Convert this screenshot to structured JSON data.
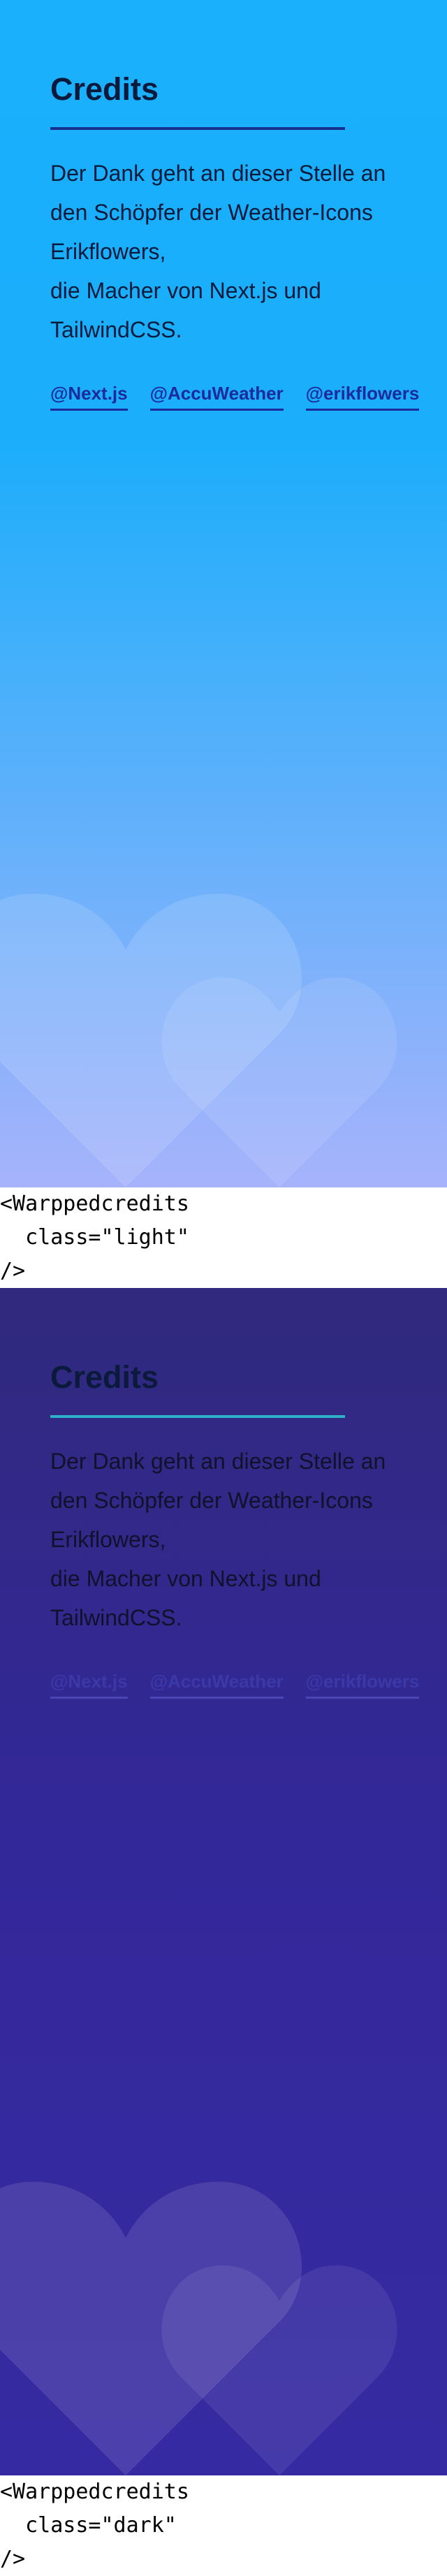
{
  "panels": [
    {
      "title": "Credits",
      "lines": [
        "Der Dank geht an dieser Stelle an",
        "den Schöpfer der Weather-Icons",
        "Erikflowers,",
        "die Macher von Next.js und",
        "TailwindCSS."
      ],
      "links": [
        "@Next.js",
        "@AccuWeather",
        "@erikflowers"
      ],
      "code": "<Warppedcredits\n  class=\"light\"\n/>"
    },
    {
      "title": "Credits",
      "lines": [
        "Der Dank geht an dieser Stelle an",
        "den Schöpfer der Weather-Icons",
        "Erikflowers,",
        "die Macher von Next.js und",
        "TailwindCSS."
      ],
      "links": [
        "@Next.js",
        "@AccuWeather",
        "@erikflowers"
      ],
      "code": "<Warppedcredits\n  class=\"dark\"\n/>"
    }
  ],
  "colors": {
    "light_bg_top": "#1ab0fc",
    "light_bg_bottom": "#a6b3fb",
    "dark_bg_top": "#30297d",
    "dark_bg_bottom": "#362aa2",
    "dark_rule": "#2fb0c8",
    "light_rule": "#14308c"
  }
}
